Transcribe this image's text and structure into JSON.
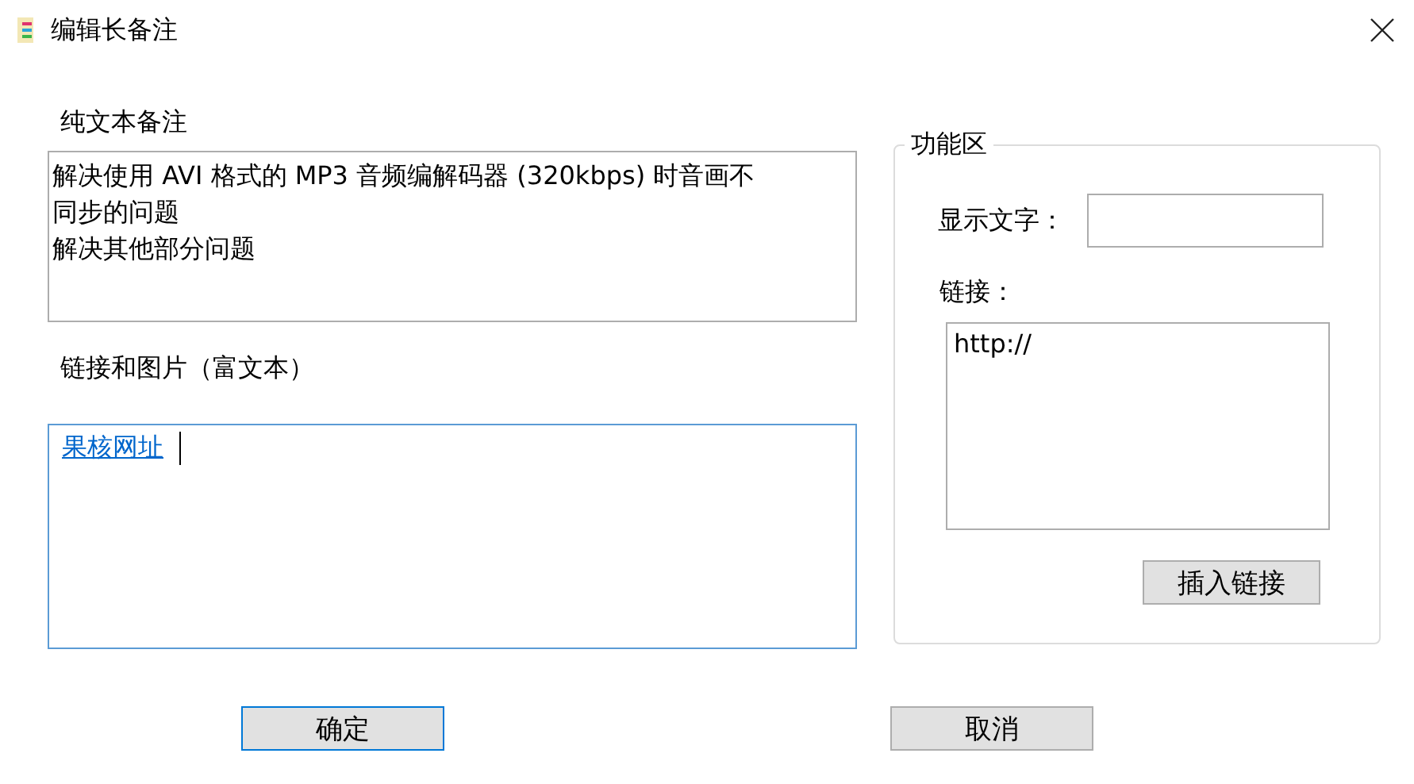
{
  "window": {
    "title": "编辑长备注"
  },
  "plain_note": {
    "label": "纯文本备注",
    "lines": [
      "解决使用 AVI 格式的 MP3 音频编解码器 (320kbps) 时音画不",
      "同步的问题",
      "解决其他部分问题"
    ]
  },
  "rich_note": {
    "label": "链接和图片（富文本）",
    "link": "果核网址"
  },
  "function_area": {
    "title": "功能区",
    "display_text": {
      "label": "显示文字："
    },
    "link": {
      "label": "链接：",
      "value": "http://"
    },
    "insert_button": "插入链接"
  },
  "buttons": [
    {
      "label": "确定",
      "default": true
    },
    {
      "label": "取消",
      "default": false
    }
  ]
}
